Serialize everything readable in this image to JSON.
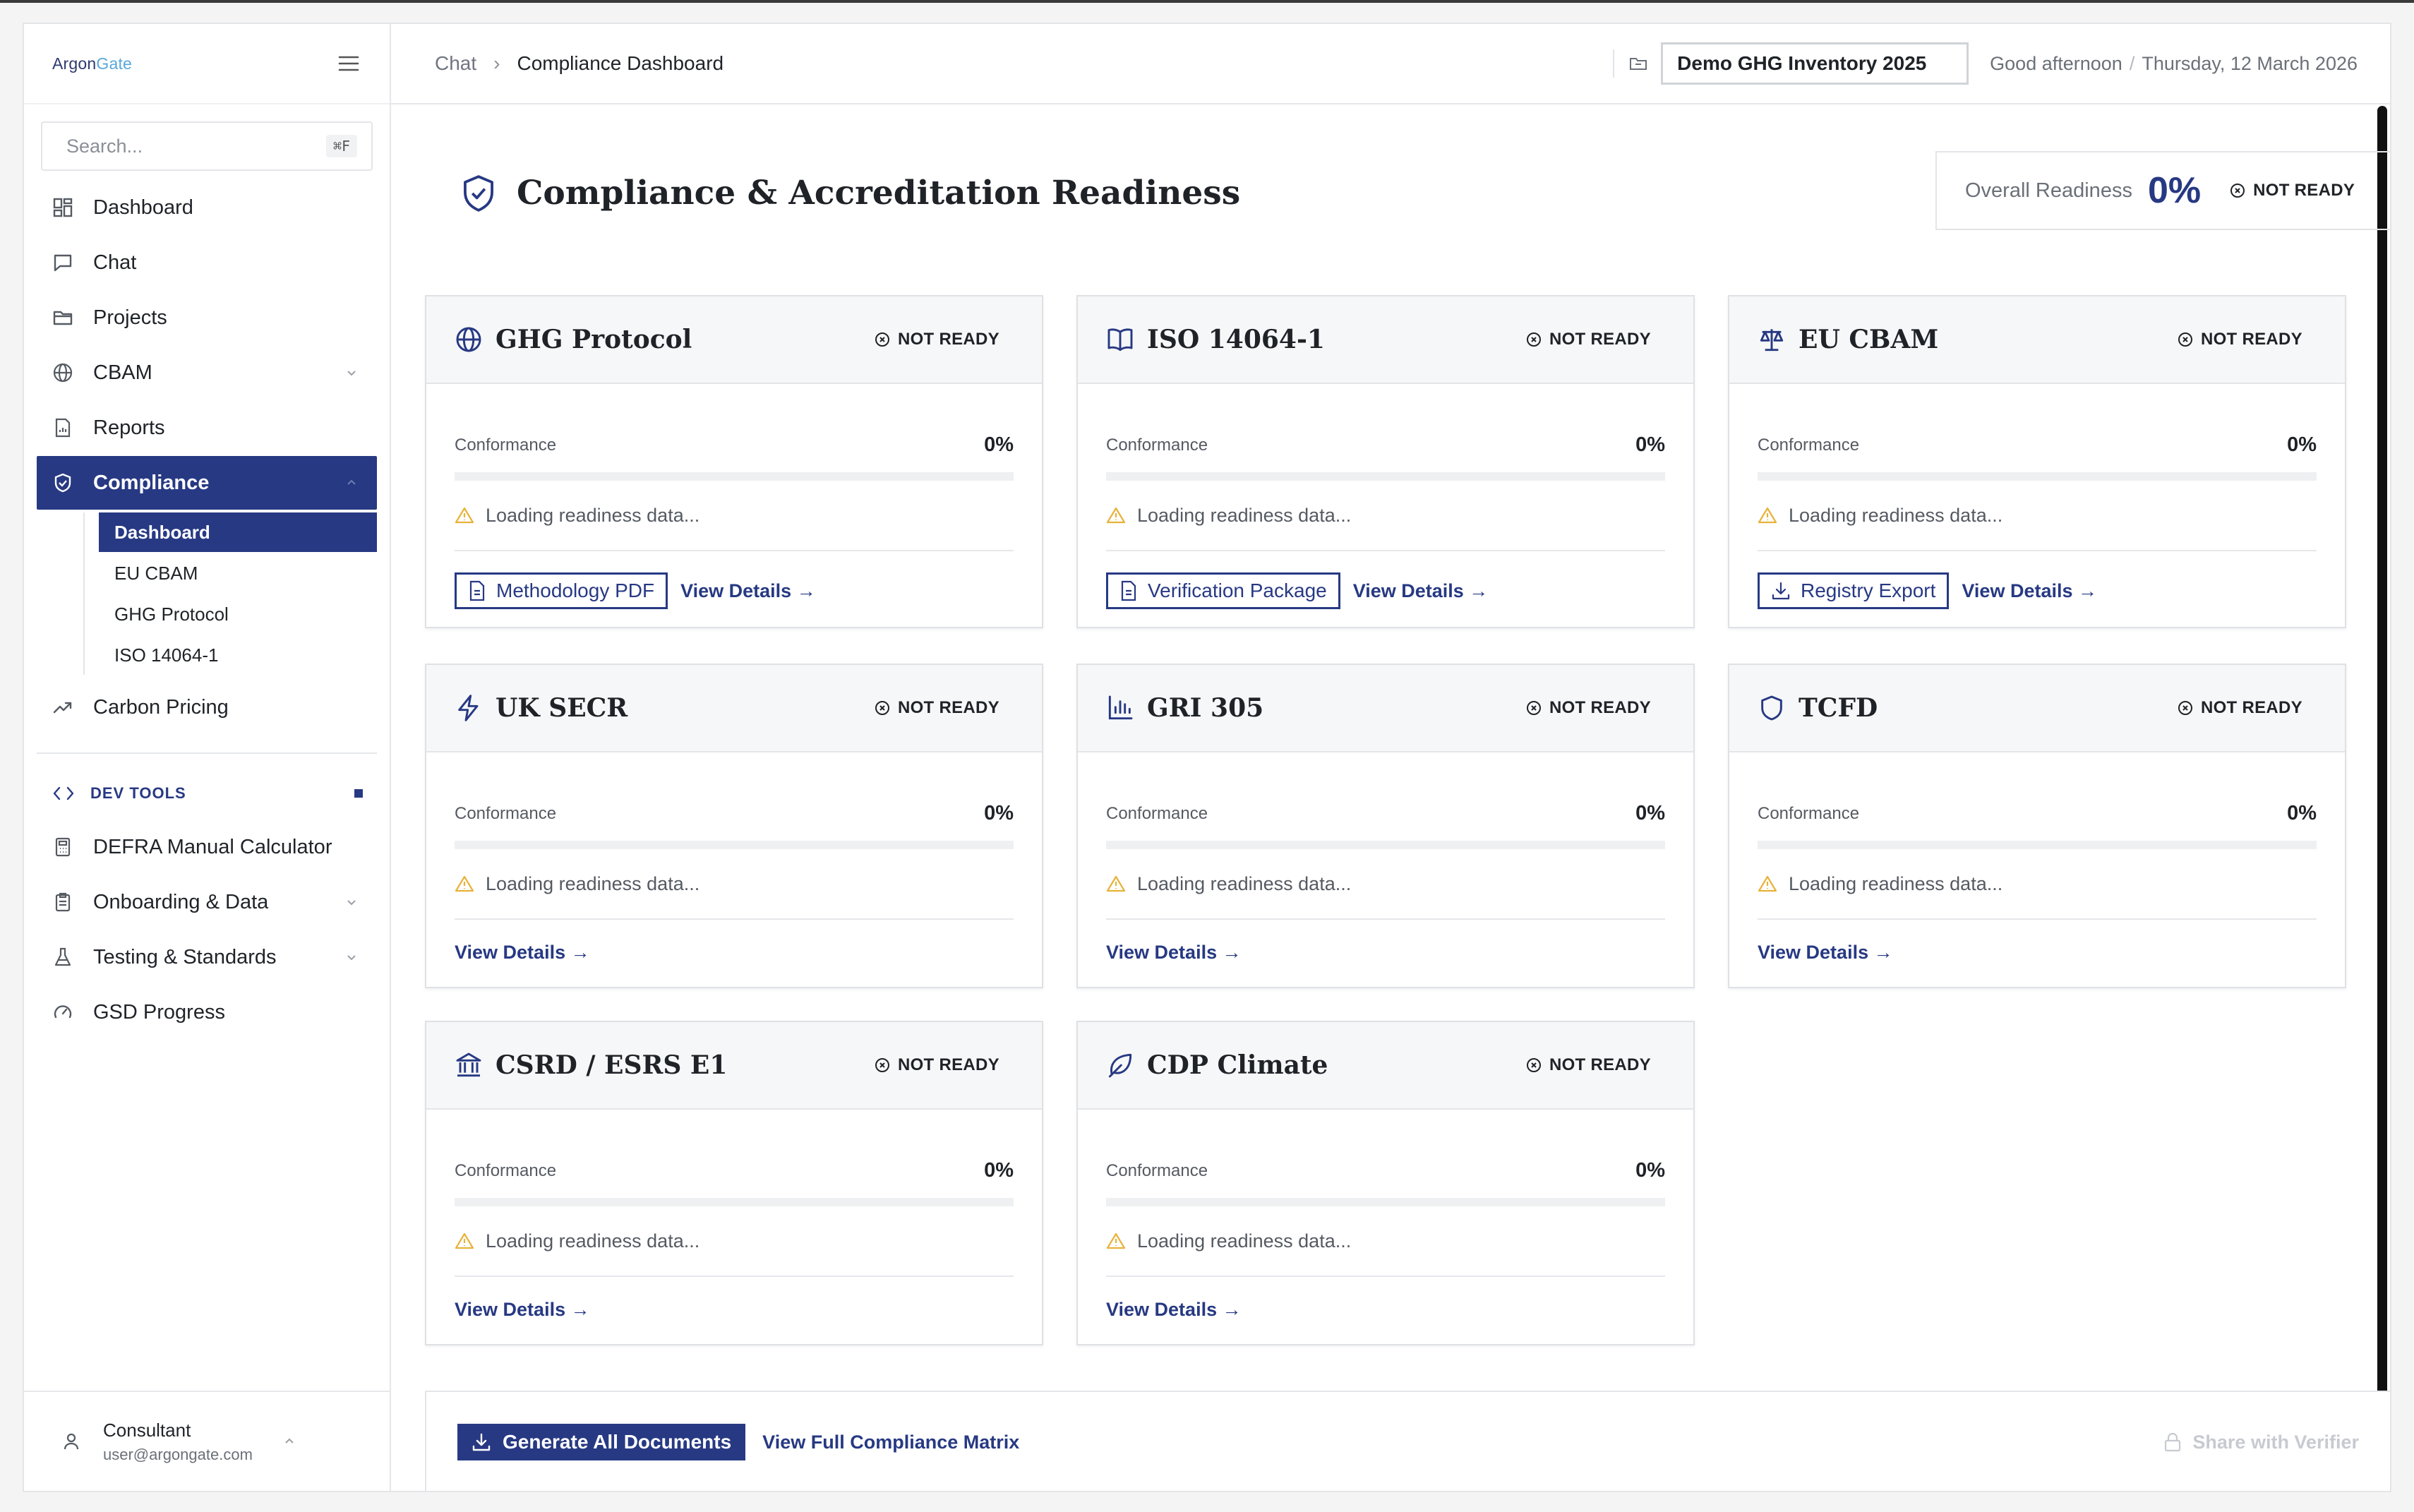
{
  "app": {
    "logo": {
      "part1": "Argon",
      "part2": "Gate"
    }
  },
  "sidebar": {
    "search": {
      "placeholder": "Search...",
      "shortcut": "⌘F"
    },
    "items": [
      {
        "label": "Dashboard",
        "icon": "grid-icon"
      },
      {
        "label": "Chat",
        "icon": "chat-icon"
      },
      {
        "label": "Projects",
        "icon": "folder-icon"
      },
      {
        "label": "CBAM",
        "icon": "globe-icon"
      },
      {
        "label": "Reports",
        "icon": "report-icon"
      },
      {
        "label": "Compliance",
        "icon": "shield-icon"
      }
    ],
    "compliance_sub": [
      "Dashboard",
      "EU CBAM",
      "GHG Protocol",
      "ISO 14064-1"
    ],
    "carbon_pricing": "Carbon Pricing",
    "dev_tools_label": "DEV TOOLS",
    "dev_items": [
      {
        "label": "DEFRA Manual Calculator"
      },
      {
        "label": "Onboarding & Data"
      },
      {
        "label": "Testing & Standards"
      },
      {
        "label": "GSD Progress"
      }
    ],
    "user": {
      "name": "Consultant",
      "email": "user@argongate.com"
    }
  },
  "topbar": {
    "breadcrumb": [
      "Chat",
      "Compliance Dashboard"
    ],
    "project": "Demo GHG Inventory 2025",
    "greeting": "Good afternoon",
    "date": "Thursday, 12 March 2026"
  },
  "page": {
    "title": "Compliance & Accreditation Readiness",
    "overall_label": "Overall Readiness",
    "overall_value": "0%",
    "overall_status": "NOT READY"
  },
  "common": {
    "status": "NOT READY",
    "conformance_label": "Conformance",
    "conformance_value": "0%",
    "loading": "Loading readiness data...",
    "view_details": "View Details →"
  },
  "frameworks": [
    {
      "name": "GHG Protocol",
      "icon": "globe-icon",
      "conformance": 0,
      "doc_button": "Methodology PDF",
      "doc_icon": "document-icon"
    },
    {
      "name": "ISO 14064-1",
      "icon": "book-icon",
      "conformance": 0,
      "doc_button": "Verification Package",
      "doc_icon": "document-icon"
    },
    {
      "name": "EU CBAM",
      "icon": "scale-icon",
      "conformance": 0,
      "doc_button": "Registry Export",
      "doc_icon": "download-icon"
    },
    {
      "name": "UK SECR",
      "icon": "lightning-icon",
      "conformance": 0
    },
    {
      "name": "GRI 305",
      "icon": "bar-chart-icon",
      "conformance": 0
    },
    {
      "name": "TCFD",
      "icon": "shield-icon",
      "conformance": 0
    },
    {
      "name": "CSRD / ESRS E1",
      "icon": "bank-icon",
      "conformance": 0
    },
    {
      "name": "CDP Climate",
      "icon": "leaf-icon",
      "conformance": 0
    }
  ],
  "footer": {
    "generate": "Generate All Documents",
    "matrix": "View Full Compliance Matrix",
    "share": "Share with Verifier"
  },
  "colors": {
    "accent": "#273983",
    "warning": "#e8b23a"
  }
}
